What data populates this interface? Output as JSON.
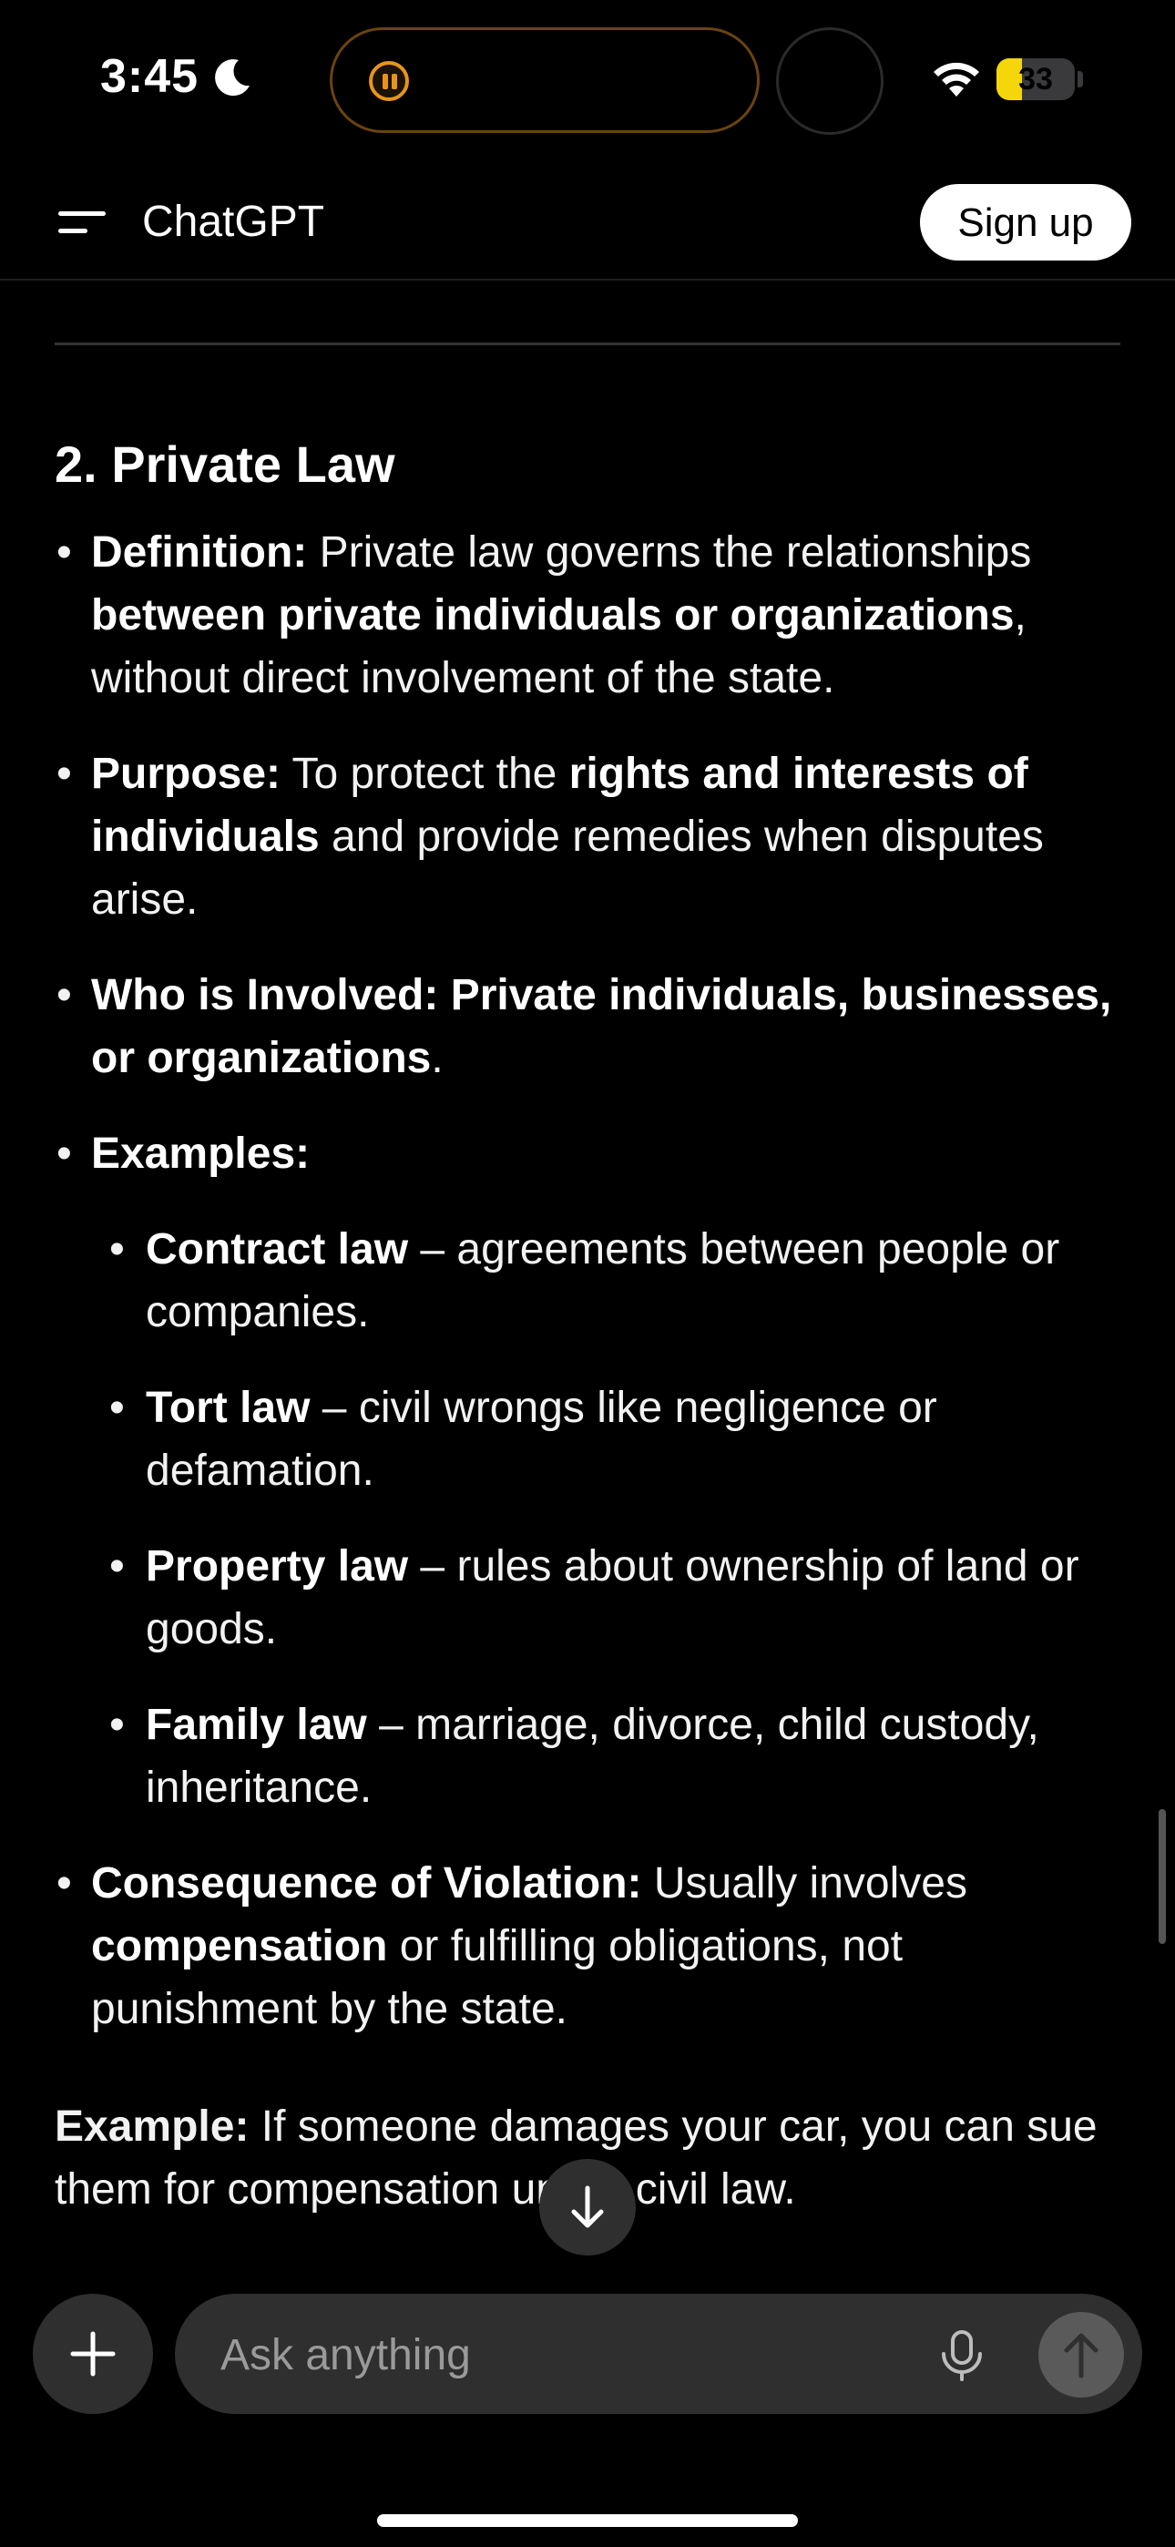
{
  "status": {
    "time": "3:45",
    "battery": "33",
    "battery_level": 0.33
  },
  "header": {
    "title": "ChatGPT",
    "signup_label": "Sign up"
  },
  "content": {
    "heading": "2. Private Law",
    "bullets": [
      {
        "label": "Definition:",
        "t1": " Private law governs the relationships ",
        "bold1": "between private individuals or organizations",
        "t2": ", without direct involvement of the state."
      },
      {
        "label": "Purpose:",
        "t1": " To protect the ",
        "bold1": "rights and interests of individuals",
        "t2": " and provide remedies when disputes arise."
      },
      {
        "label": "Who is Involved:",
        "bold1": " Private individuals, businesses, or organizations",
        "t2": "."
      },
      {
        "label": "Examples:"
      }
    ],
    "examples": [
      {
        "label": "Contract law",
        "text": " – agreements between people or companies."
      },
      {
        "label": "Tort law",
        "text": " – civil wrongs like negligence or defamation."
      },
      {
        "label": "Property law",
        "text": " – rules about ownership of land or goods."
      },
      {
        "label": "Family law",
        "text": " – marriage, divorce, child custody, inheritance."
      }
    ],
    "consequence": {
      "label": "Consequence of Violation:",
      "t1": " Usually involves ",
      "bold1": "compensation",
      "t2": " or fulfilling obligations, not punishment by the state."
    },
    "example_para": {
      "label": "Example:",
      "text": " If someone damages your car, you can sue them for compensation under civil law."
    }
  },
  "composer": {
    "placeholder": "Ask anything"
  },
  "colors": {
    "accent_battery": "#f5d60a",
    "island_orange": "#e8941c",
    "bg": "#000000"
  }
}
